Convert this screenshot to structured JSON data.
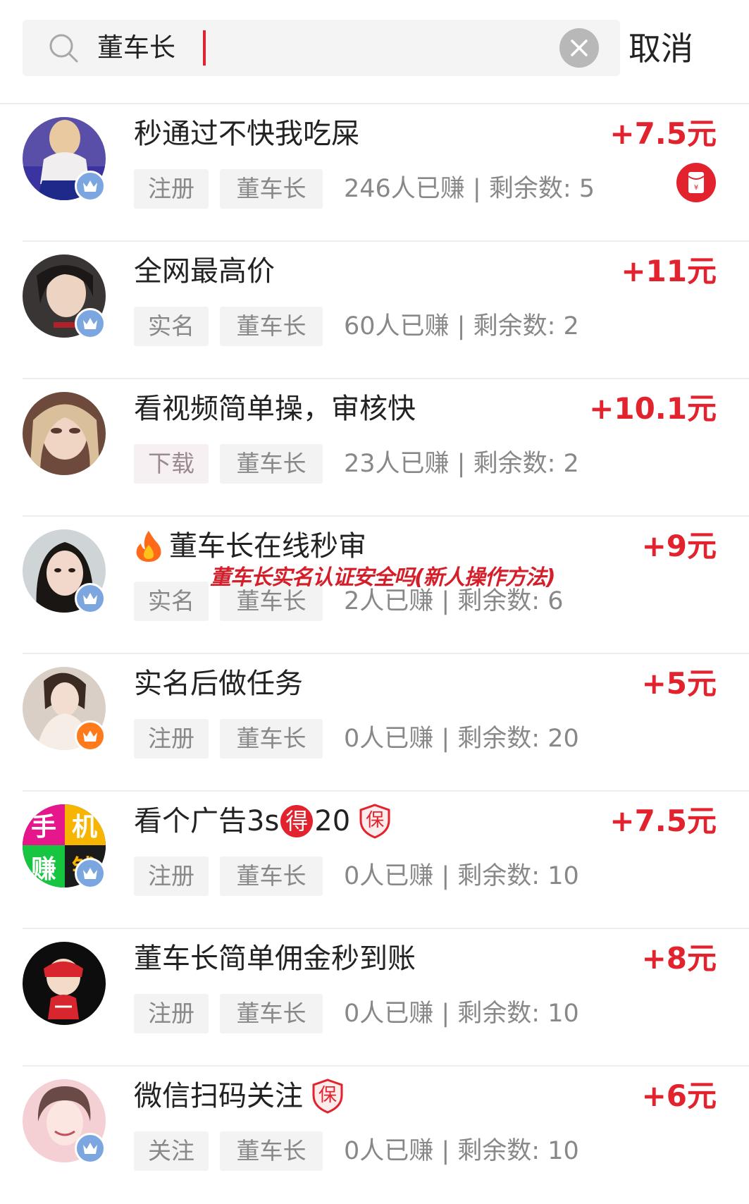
{
  "search": {
    "query": "董车长",
    "cancel_label": "取消"
  },
  "colors": {
    "accent_red": "#e2222d",
    "crown_blue": "#7ba6e0",
    "crown_orange": "#ff7a1a"
  },
  "tasks": [
    {
      "title": "秒通过不快我吃屎",
      "type_tag": "注册",
      "owner_tag": "董车长",
      "stats": "246人已赚 | 剩余数: 5",
      "reward": "+7.5元",
      "crown": "blue-crown-icon",
      "extra_icon": "red-packet-icon"
    },
    {
      "title": "全网最高价",
      "type_tag": "实名",
      "owner_tag": "董车长",
      "stats": "60人已赚 | 剩余数: 2",
      "reward": "+11元",
      "crown": "blue-crown-icon"
    },
    {
      "title": "看视频简单操，审核快",
      "type_tag": "下载",
      "owner_tag": "董车长",
      "stats": "23人已赚 | 剩余数: 2",
      "reward": "+10.1元",
      "crown": "none"
    },
    {
      "title": "董车长在线秒审",
      "title_icon": "fire-icon",
      "type_tag": "实名",
      "owner_tag": "董车长",
      "stats": "2人已赚 | 剩余数: 6",
      "reward": "+9元",
      "crown": "blue-crown-icon"
    },
    {
      "title": "实名后做任务",
      "type_tag": "注册",
      "owner_tag": "董车长",
      "stats": "0人已赚 | 剩余数: 20",
      "reward": "+5元",
      "crown": "orange-crown-icon"
    },
    {
      "title_pre": "看个广告3s",
      "title_badge": "得",
      "title_post": "20",
      "title_shield": "保",
      "type_tag": "注册",
      "owner_tag": "董车长",
      "stats": "0人已赚 | 剩余数: 10",
      "reward": "+7.5元",
      "crown": "blue-crown-icon"
    },
    {
      "title": "董车长简单佣金秒到账",
      "type_tag": "注册",
      "owner_tag": "董车长",
      "stats": "0人已赚 | 剩余数: 10",
      "reward": "+8元",
      "crown": "none"
    },
    {
      "title": "微信扫码关注",
      "title_shield": "保",
      "type_tag": "关注",
      "owner_tag": "董车长",
      "stats": "0人已赚 | 剩余数: 10",
      "reward": "+6元",
      "crown": "blue-crown-icon"
    }
  ],
  "watermark": "董车长实名认证安全吗(新人操作方法)"
}
